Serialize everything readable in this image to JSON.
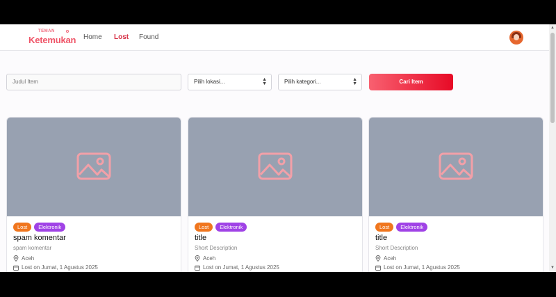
{
  "brand": {
    "small": "TEMAN",
    "name": "Ketemukan"
  },
  "nav": {
    "home": "Home",
    "lost": "Lost",
    "found": "Found"
  },
  "search": {
    "title_placeholder": "Judul Item",
    "location": "Pilih lokasi...",
    "category": "Pilih kategori...",
    "button": "Cari Item"
  },
  "cards": [
    {
      "status": "Lost",
      "category": "Elektronik",
      "title": "spam komentar",
      "description": "spam komentar",
      "location": "Aceh",
      "date": "Lost on Jumat, 1 Agustus 2025"
    },
    {
      "status": "Lost",
      "category": "Elektronik",
      "title": "title",
      "description": "Short Description",
      "location": "Aceh",
      "date": "Lost on Jumat, 1 Agustus 2025"
    },
    {
      "status": "Lost",
      "category": "Elektronik",
      "title": "title",
      "description": "Short Description",
      "location": "Aceh",
      "date": "Lost on Jumat, 1 Agustus 2025"
    }
  ],
  "colors": {
    "accent": "#e70a26",
    "nav_active": "#d62f44",
    "tag_lost": "#f0761e",
    "tag_category": "#a043e6",
    "thumb": "#98a1b1"
  },
  "icons": {
    "thumbnail": "image-placeholder-icon",
    "location": "map-pin-icon",
    "date": "calendar-icon"
  }
}
